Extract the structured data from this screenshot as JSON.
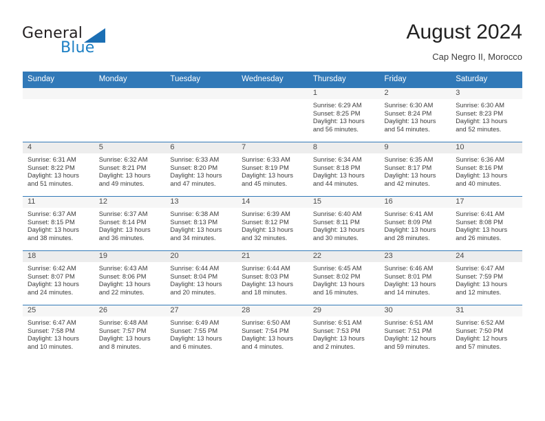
{
  "brand": {
    "name_part1": "General",
    "name_part2": "Blue",
    "triangle_color": "#1b6fb4",
    "blue_color": "#1c7fc4"
  },
  "header": {
    "title": "August 2024",
    "subtitle": "Cap Negro II, Morocco",
    "header_bg": "#3179b8",
    "header_text_color": "#ffffff"
  },
  "weekdays": [
    "Sunday",
    "Monday",
    "Tuesday",
    "Wednesday",
    "Thursday",
    "Friday",
    "Saturday"
  ],
  "weeks": [
    [
      {
        "day": "",
        "sunrise": "",
        "sunset": "",
        "daylight_line1": "",
        "daylight_line2": ""
      },
      {
        "day": "",
        "sunrise": "",
        "sunset": "",
        "daylight_line1": "",
        "daylight_line2": ""
      },
      {
        "day": "",
        "sunrise": "",
        "sunset": "",
        "daylight_line1": "",
        "daylight_line2": ""
      },
      {
        "day": "",
        "sunrise": "",
        "sunset": "",
        "daylight_line1": "",
        "daylight_line2": ""
      },
      {
        "day": "1",
        "sunrise": "Sunrise: 6:29 AM",
        "sunset": "Sunset: 8:25 PM",
        "daylight_line1": "Daylight: 13 hours",
        "daylight_line2": "and 56 minutes."
      },
      {
        "day": "2",
        "sunrise": "Sunrise: 6:30 AM",
        "sunset": "Sunset: 8:24 PM",
        "daylight_line1": "Daylight: 13 hours",
        "daylight_line2": "and 54 minutes."
      },
      {
        "day": "3",
        "sunrise": "Sunrise: 6:30 AM",
        "sunset": "Sunset: 8:23 PM",
        "daylight_line1": "Daylight: 13 hours",
        "daylight_line2": "and 52 minutes."
      }
    ],
    [
      {
        "day": "4",
        "sunrise": "Sunrise: 6:31 AM",
        "sunset": "Sunset: 8:22 PM",
        "daylight_line1": "Daylight: 13 hours",
        "daylight_line2": "and 51 minutes."
      },
      {
        "day": "5",
        "sunrise": "Sunrise: 6:32 AM",
        "sunset": "Sunset: 8:21 PM",
        "daylight_line1": "Daylight: 13 hours",
        "daylight_line2": "and 49 minutes."
      },
      {
        "day": "6",
        "sunrise": "Sunrise: 6:33 AM",
        "sunset": "Sunset: 8:20 PM",
        "daylight_line1": "Daylight: 13 hours",
        "daylight_line2": "and 47 minutes."
      },
      {
        "day": "7",
        "sunrise": "Sunrise: 6:33 AM",
        "sunset": "Sunset: 8:19 PM",
        "daylight_line1": "Daylight: 13 hours",
        "daylight_line2": "and 45 minutes."
      },
      {
        "day": "8",
        "sunrise": "Sunrise: 6:34 AM",
        "sunset": "Sunset: 8:18 PM",
        "daylight_line1": "Daylight: 13 hours",
        "daylight_line2": "and 44 minutes."
      },
      {
        "day": "9",
        "sunrise": "Sunrise: 6:35 AM",
        "sunset": "Sunset: 8:17 PM",
        "daylight_line1": "Daylight: 13 hours",
        "daylight_line2": "and 42 minutes."
      },
      {
        "day": "10",
        "sunrise": "Sunrise: 6:36 AM",
        "sunset": "Sunset: 8:16 PM",
        "daylight_line1": "Daylight: 13 hours",
        "daylight_line2": "and 40 minutes."
      }
    ],
    [
      {
        "day": "11",
        "sunrise": "Sunrise: 6:37 AM",
        "sunset": "Sunset: 8:15 PM",
        "daylight_line1": "Daylight: 13 hours",
        "daylight_line2": "and 38 minutes."
      },
      {
        "day": "12",
        "sunrise": "Sunrise: 6:37 AM",
        "sunset": "Sunset: 8:14 PM",
        "daylight_line1": "Daylight: 13 hours",
        "daylight_line2": "and 36 minutes."
      },
      {
        "day": "13",
        "sunrise": "Sunrise: 6:38 AM",
        "sunset": "Sunset: 8:13 PM",
        "daylight_line1": "Daylight: 13 hours",
        "daylight_line2": "and 34 minutes."
      },
      {
        "day": "14",
        "sunrise": "Sunrise: 6:39 AM",
        "sunset": "Sunset: 8:12 PM",
        "daylight_line1": "Daylight: 13 hours",
        "daylight_line2": "and 32 minutes."
      },
      {
        "day": "15",
        "sunrise": "Sunrise: 6:40 AM",
        "sunset": "Sunset: 8:11 PM",
        "daylight_line1": "Daylight: 13 hours",
        "daylight_line2": "and 30 minutes."
      },
      {
        "day": "16",
        "sunrise": "Sunrise: 6:41 AM",
        "sunset": "Sunset: 8:09 PM",
        "daylight_line1": "Daylight: 13 hours",
        "daylight_line2": "and 28 minutes."
      },
      {
        "day": "17",
        "sunrise": "Sunrise: 6:41 AM",
        "sunset": "Sunset: 8:08 PM",
        "daylight_line1": "Daylight: 13 hours",
        "daylight_line2": "and 26 minutes."
      }
    ],
    [
      {
        "day": "18",
        "sunrise": "Sunrise: 6:42 AM",
        "sunset": "Sunset: 8:07 PM",
        "daylight_line1": "Daylight: 13 hours",
        "daylight_line2": "and 24 minutes."
      },
      {
        "day": "19",
        "sunrise": "Sunrise: 6:43 AM",
        "sunset": "Sunset: 8:06 PM",
        "daylight_line1": "Daylight: 13 hours",
        "daylight_line2": "and 22 minutes."
      },
      {
        "day": "20",
        "sunrise": "Sunrise: 6:44 AM",
        "sunset": "Sunset: 8:04 PM",
        "daylight_line1": "Daylight: 13 hours",
        "daylight_line2": "and 20 minutes."
      },
      {
        "day": "21",
        "sunrise": "Sunrise: 6:44 AM",
        "sunset": "Sunset: 8:03 PM",
        "daylight_line1": "Daylight: 13 hours",
        "daylight_line2": "and 18 minutes."
      },
      {
        "day": "22",
        "sunrise": "Sunrise: 6:45 AM",
        "sunset": "Sunset: 8:02 PM",
        "daylight_line1": "Daylight: 13 hours",
        "daylight_line2": "and 16 minutes."
      },
      {
        "day": "23",
        "sunrise": "Sunrise: 6:46 AM",
        "sunset": "Sunset: 8:01 PM",
        "daylight_line1": "Daylight: 13 hours",
        "daylight_line2": "and 14 minutes."
      },
      {
        "day": "24",
        "sunrise": "Sunrise: 6:47 AM",
        "sunset": "Sunset: 7:59 PM",
        "daylight_line1": "Daylight: 13 hours",
        "daylight_line2": "and 12 minutes."
      }
    ],
    [
      {
        "day": "25",
        "sunrise": "Sunrise: 6:47 AM",
        "sunset": "Sunset: 7:58 PM",
        "daylight_line1": "Daylight: 13 hours",
        "daylight_line2": "and 10 minutes."
      },
      {
        "day": "26",
        "sunrise": "Sunrise: 6:48 AM",
        "sunset": "Sunset: 7:57 PM",
        "daylight_line1": "Daylight: 13 hours",
        "daylight_line2": "and 8 minutes."
      },
      {
        "day": "27",
        "sunrise": "Sunrise: 6:49 AM",
        "sunset": "Sunset: 7:55 PM",
        "daylight_line1": "Daylight: 13 hours",
        "daylight_line2": "and 6 minutes."
      },
      {
        "day": "28",
        "sunrise": "Sunrise: 6:50 AM",
        "sunset": "Sunset: 7:54 PM",
        "daylight_line1": "Daylight: 13 hours",
        "daylight_line2": "and 4 minutes."
      },
      {
        "day": "29",
        "sunrise": "Sunrise: 6:51 AM",
        "sunset": "Sunset: 7:53 PM",
        "daylight_line1": "Daylight: 13 hours",
        "daylight_line2": "and 2 minutes."
      },
      {
        "day": "30",
        "sunrise": "Sunrise: 6:51 AM",
        "sunset": "Sunset: 7:51 PM",
        "daylight_line1": "Daylight: 12 hours",
        "daylight_line2": "and 59 minutes."
      },
      {
        "day": "31",
        "sunrise": "Sunrise: 6:52 AM",
        "sunset": "Sunset: 7:50 PM",
        "daylight_line1": "Daylight: 12 hours",
        "daylight_line2": "and 57 minutes."
      }
    ]
  ]
}
